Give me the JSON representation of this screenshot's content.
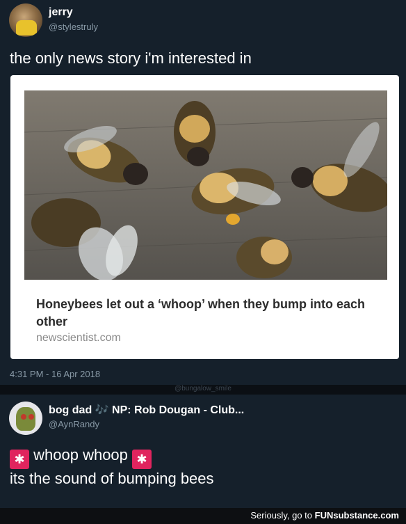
{
  "tweet1": {
    "name": "jerry",
    "handle": "@stylestruly",
    "text": "the only news story i'm interested in",
    "card": {
      "title": "Honeybees let out a ‘whoop’ when they bump into each other",
      "url": "newscientist.com"
    },
    "timestamp": "4:31 PM - 16 Apr 2018"
  },
  "watermark": "@bungalow_smile",
  "tweet2": {
    "name": "bog dad",
    "music_note": "🎶",
    "now_playing": "NP: Rob Dougan - Club...",
    "handle": "@AynRandy",
    "siren_icon": "🚨",
    "line1": "whoop whoop",
    "line2": "its the sound of bumping bees"
  },
  "footer": {
    "text": "Seriously, go to ",
    "brand": "FUNsubstance.com"
  },
  "colors": {
    "background": "#15202b",
    "secondary_text": "#8899a6",
    "siren": "#e0245e"
  }
}
